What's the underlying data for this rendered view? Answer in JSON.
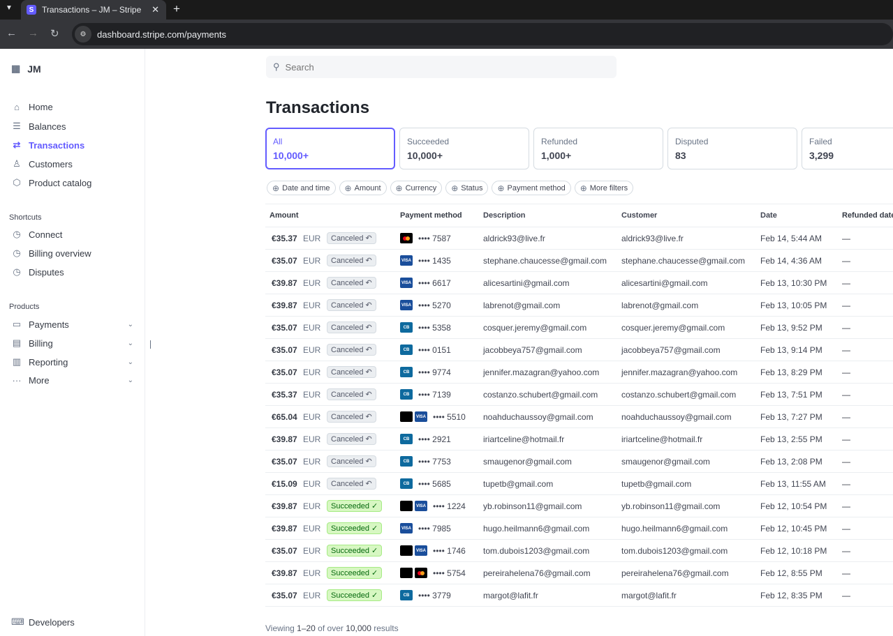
{
  "browser": {
    "tab_title": "Transactions – JM – Stripe",
    "url": "dashboard.stripe.com/payments"
  },
  "sidebar": {
    "account": "JM",
    "items": [
      {
        "label": "Home",
        "icon": "home-icon"
      },
      {
        "label": "Balances",
        "icon": "balances-icon"
      },
      {
        "label": "Transactions",
        "icon": "transactions-icon",
        "active": true
      },
      {
        "label": "Customers",
        "icon": "user-icon"
      },
      {
        "label": "Product catalog",
        "icon": "box-icon"
      }
    ],
    "shortcuts_heading": "Shortcuts",
    "shortcuts": [
      {
        "label": "Connect"
      },
      {
        "label": "Billing overview"
      },
      {
        "label": "Disputes"
      }
    ],
    "products_heading": "Products",
    "products": [
      {
        "label": "Payments"
      },
      {
        "label": "Billing"
      },
      {
        "label": "Reporting"
      },
      {
        "label": "More"
      }
    ],
    "developers": "Developers"
  },
  "search": {
    "placeholder": "Search"
  },
  "page_title": "Transactions",
  "status_cards": [
    {
      "label": "All",
      "value": "10,000+"
    },
    {
      "label": "Succeeded",
      "value": "10,000+"
    },
    {
      "label": "Refunded",
      "value": "1,000+"
    },
    {
      "label": "Disputed",
      "value": "83"
    },
    {
      "label": "Failed",
      "value": "3,299"
    }
  ],
  "filters": [
    "Date and time",
    "Amount",
    "Currency",
    "Status",
    "Payment method",
    "More filters"
  ],
  "columns": [
    "Amount",
    "Payment method",
    "Description",
    "Customer",
    "Date",
    "Refunded date"
  ],
  "rows": [
    {
      "amount": "€35.37",
      "currency": "EUR",
      "status": "Canceled",
      "brands": [
        "mastercard"
      ],
      "last4": "7587",
      "description": "aldrick93@live.fr",
      "customer": "aldrick93@live.fr",
      "date": "Feb 14, 5:44 AM",
      "refunded": "—"
    },
    {
      "amount": "€35.07",
      "currency": "EUR",
      "status": "Canceled",
      "brands": [
        "visa"
      ],
      "last4": "1435",
      "description": "stephane.chaucesse@gmail.com",
      "customer": "stephane.chaucesse@gmail.com",
      "date": "Feb 14, 4:36 AM",
      "refunded": "—"
    },
    {
      "amount": "€39.87",
      "currency": "EUR",
      "status": "Canceled",
      "brands": [
        "visa"
      ],
      "last4": "6617",
      "description": "alicesartini@gmail.com",
      "customer": "alicesartini@gmail.com",
      "date": "Feb 13, 10:30 PM",
      "refunded": "—"
    },
    {
      "amount": "€39.87",
      "currency": "EUR",
      "status": "Canceled",
      "brands": [
        "visa"
      ],
      "last4": "5270",
      "description": "labrenot@gmail.com",
      "customer": "labrenot@gmail.com",
      "date": "Feb 13, 10:05 PM",
      "refunded": "—"
    },
    {
      "amount": "€35.07",
      "currency": "EUR",
      "status": "Canceled",
      "brands": [
        "cb"
      ],
      "last4": "5358",
      "description": "cosquer.jeremy@gmail.com",
      "customer": "cosquer.jeremy@gmail.com",
      "date": "Feb 13, 9:52 PM",
      "refunded": "—"
    },
    {
      "amount": "€35.07",
      "currency": "EUR",
      "status": "Canceled",
      "brands": [
        "cb"
      ],
      "last4": "0151",
      "description": "jacobbeya757@gmail.com",
      "customer": "jacobbeya757@gmail.com",
      "date": "Feb 13, 9:14 PM",
      "refunded": "—"
    },
    {
      "amount": "€35.07",
      "currency": "EUR",
      "status": "Canceled",
      "brands": [
        "cb"
      ],
      "last4": "9774",
      "description": "jennifer.mazagran@yahoo.com",
      "customer": "jennifer.mazagran@yahoo.com",
      "date": "Feb 13, 8:29 PM",
      "refunded": "—"
    },
    {
      "amount": "€35.37",
      "currency": "EUR",
      "status": "Canceled",
      "brands": [
        "cb"
      ],
      "last4": "7139",
      "description": "costanzo.schubert@gmail.com",
      "customer": "costanzo.schubert@gmail.com",
      "date": "Feb 13, 7:51 PM",
      "refunded": "—"
    },
    {
      "amount": "€65.04",
      "currency": "EUR",
      "status": "Canceled",
      "brands": [
        "apple",
        "visa"
      ],
      "last4": "5510",
      "description": "noahduchaussoy@gmail.com",
      "customer": "noahduchaussoy@gmail.com",
      "date": "Feb 13, 7:27 PM",
      "refunded": "—"
    },
    {
      "amount": "€39.87",
      "currency": "EUR",
      "status": "Canceled",
      "brands": [
        "cb"
      ],
      "last4": "2921",
      "description": "iriartceline@hotmail.fr",
      "customer": "iriartceline@hotmail.fr",
      "date": "Feb 13, 2:55 PM",
      "refunded": "—"
    },
    {
      "amount": "€35.07",
      "currency": "EUR",
      "status": "Canceled",
      "brands": [
        "cb"
      ],
      "last4": "7753",
      "description": "smaugenor@gmail.com",
      "customer": "smaugenor@gmail.com",
      "date": "Feb 13, 2:08 PM",
      "refunded": "—"
    },
    {
      "amount": "€15.09",
      "currency": "EUR",
      "status": "Canceled",
      "brands": [
        "cb"
      ],
      "last4": "5685",
      "description": "tupetb@gmail.com",
      "customer": "tupetb@gmail.com",
      "date": "Feb 13, 11:55 AM",
      "refunded": "—"
    },
    {
      "amount": "€39.87",
      "currency": "EUR",
      "status": "Succeeded",
      "brands": [
        "apple",
        "visa"
      ],
      "last4": "1224",
      "description": "yb.robinson11@gmail.com",
      "customer": "yb.robinson11@gmail.com",
      "date": "Feb 12, 10:54 PM",
      "refunded": "—"
    },
    {
      "amount": "€39.87",
      "currency": "EUR",
      "status": "Succeeded",
      "brands": [
        "visa"
      ],
      "last4": "7985",
      "description": "hugo.heilmann6@gmail.com",
      "customer": "hugo.heilmann6@gmail.com",
      "date": "Feb 12, 10:45 PM",
      "refunded": "—"
    },
    {
      "amount": "€35.07",
      "currency": "EUR",
      "status": "Succeeded",
      "brands": [
        "apple",
        "visa"
      ],
      "last4": "1746",
      "description": "tom.dubois1203@gmail.com",
      "customer": "tom.dubois1203@gmail.com",
      "date": "Feb 12, 10:18 PM",
      "refunded": "—"
    },
    {
      "amount": "€39.87",
      "currency": "EUR",
      "status": "Succeeded",
      "brands": [
        "apple",
        "mastercard"
      ],
      "last4": "5754",
      "description": "pereirahelena76@gmail.com",
      "customer": "pereirahelena76@gmail.com",
      "date": "Feb 12, 8:55 PM",
      "refunded": "—"
    },
    {
      "amount": "€35.07",
      "currency": "EUR",
      "status": "Succeeded",
      "brands": [
        "cb"
      ],
      "last4": "3779",
      "description": "margot@lafit.fr",
      "customer": "margot@lafit.fr",
      "date": "Feb 12, 8:35 PM",
      "refunded": "—"
    }
  ],
  "footer": {
    "prefix": "Viewing ",
    "range": "1–20",
    "middle": " of over ",
    "total": "10,000",
    "suffix": " results"
  },
  "colors": {
    "accent": "#635bff",
    "succeeded_bg": "#d7f7c2",
    "canceled_bg": "#ebeef1"
  }
}
